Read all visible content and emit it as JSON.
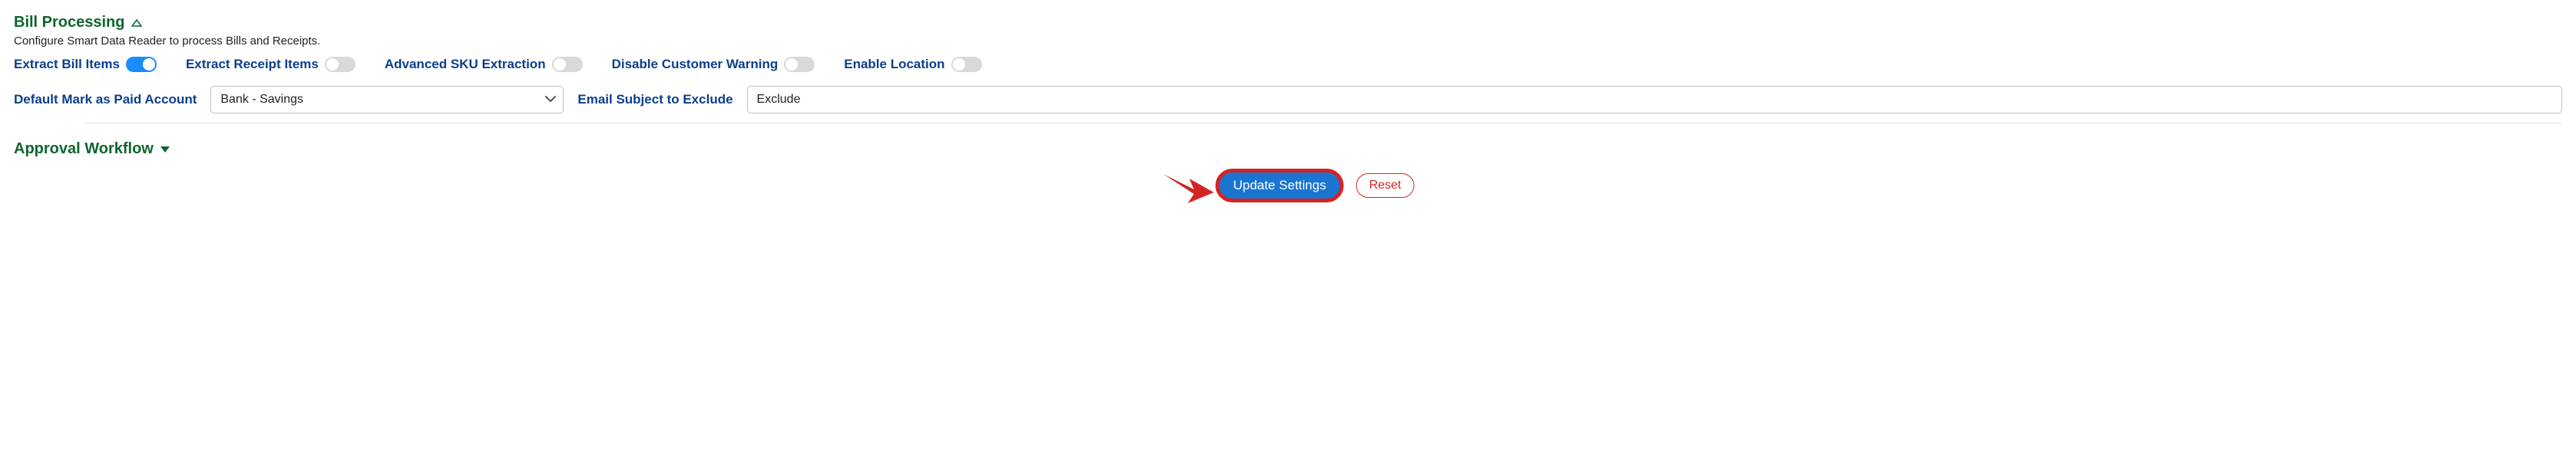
{
  "bill_processing": {
    "title": "Bill Processing",
    "description": "Configure Smart Data Reader to process Bills and Receipts.",
    "toggles": {
      "extract_bill_items": {
        "label": "Extract Bill Items",
        "state": "on"
      },
      "extract_receipt_items": {
        "label": "Extract Receipt Items",
        "state": "off"
      },
      "advanced_sku": {
        "label": "Advanced SKU Extraction",
        "state": "off"
      },
      "disable_customer_warning": {
        "label": "Disable Customer Warning",
        "state": "off"
      },
      "enable_location": {
        "label": "Enable Location",
        "state": "off"
      }
    },
    "fields": {
      "default_mark_paid_account": {
        "label": "Default Mark as Paid Account",
        "value": "Bank - Savings"
      },
      "email_subject_exclude": {
        "label": "Email Subject to Exclude",
        "value": "Exclude"
      }
    }
  },
  "approval_workflow": {
    "title": "Approval Workflow"
  },
  "actions": {
    "update_settings": "Update Settings",
    "reset": "Reset"
  }
}
